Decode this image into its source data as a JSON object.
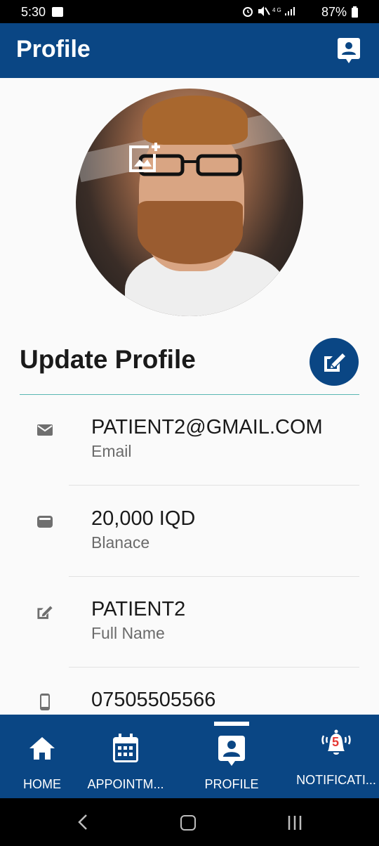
{
  "status_bar": {
    "time": "5:30",
    "icons": "⏰ 🔇 4G .ıll",
    "battery": "87%"
  },
  "app_bar": {
    "title": "Profile",
    "icon": "contact-card-icon"
  },
  "profile": {
    "avatar": "profile-photo",
    "add_photo_icon": "add-photo-icon"
  },
  "section": {
    "title": "Update Profile",
    "edit_icon": "edit-profile-icon"
  },
  "info_rows": [
    {
      "icon": "email-icon",
      "value": "PATIENT2@GMAIL.COM",
      "label": "Email"
    },
    {
      "icon": "wallet-icon",
      "value": "20,000 IQD",
      "label": "Blanace"
    },
    {
      "icon": "edit-name-icon",
      "value": "PATIENT2",
      "label": "Full Name"
    },
    {
      "icon": "phone-icon",
      "value": "07505505566",
      "label": ""
    }
  ],
  "bottom_nav": {
    "items": [
      {
        "label": "HOME",
        "icon": "home-icon"
      },
      {
        "label": "APPOINTM...",
        "icon": "calendar-icon"
      },
      {
        "label": "PROFILE",
        "icon": "profile-icon",
        "active": true
      },
      {
        "label": "NOTIFICATI...",
        "icon": "bell-icon",
        "badge": "5"
      }
    ]
  },
  "colors": {
    "primary": "#0a4684",
    "divider_accent": "#5ab6b2",
    "badge": "#e53935"
  }
}
